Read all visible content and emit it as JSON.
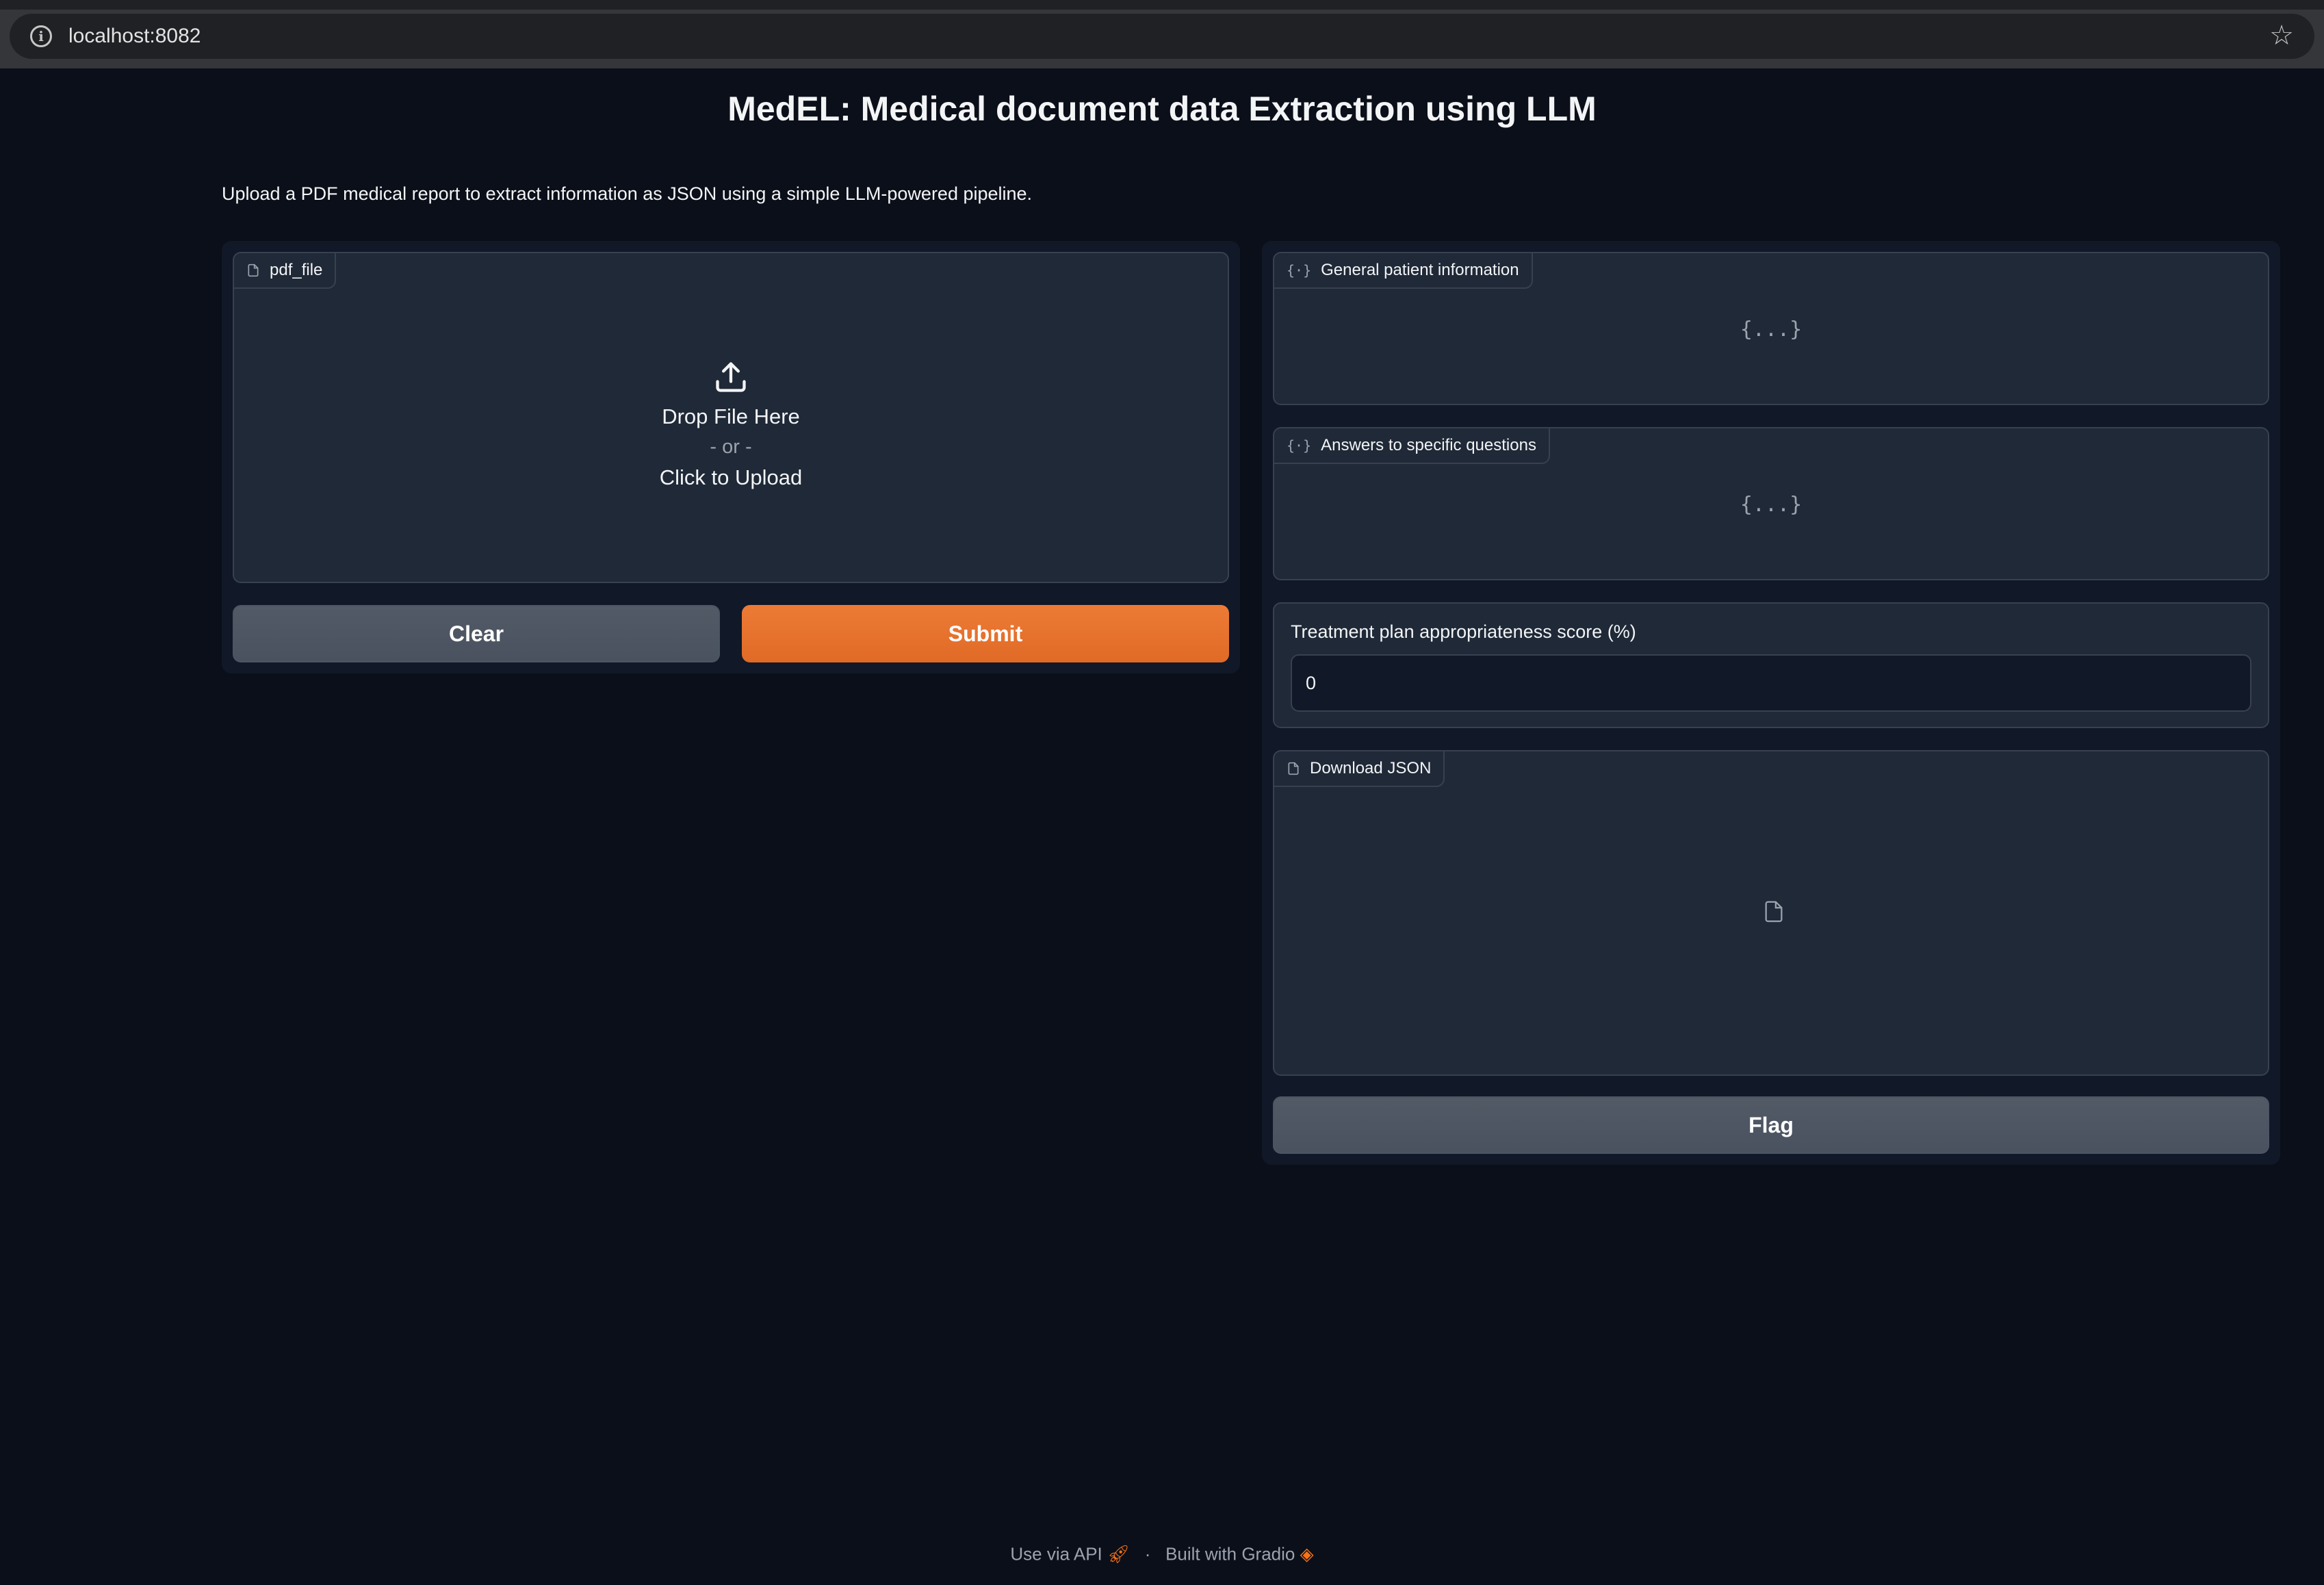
{
  "browser": {
    "url": "localhost:8082"
  },
  "page": {
    "title": "MedEL: Medical document data Extraction using LLM",
    "description": "Upload a PDF medical report to extract information as JSON using a simple LLM-powered pipeline."
  },
  "input_panel": {
    "file_label": "pdf_file",
    "drop_text": "Drop File Here",
    "or_text": "- or -",
    "click_text": "Click to Upload",
    "clear_label": "Clear",
    "submit_label": "Submit"
  },
  "output_panel": {
    "general_label": "General patient information",
    "general_empty": "{...}",
    "answers_label": "Answers to specific questions",
    "answers_empty": "{...}",
    "score_label": "Treatment plan appropriateness score (%)",
    "score_value": "0",
    "download_label": "Download JSON",
    "flag_label": "Flag"
  },
  "footer": {
    "api_text": "Use via API",
    "separator": "·",
    "built_text": "Built with Gradio"
  },
  "colors": {
    "background": "#0b0f19",
    "panel": "#111827",
    "block": "#1f2937",
    "accent": "#f97316"
  }
}
